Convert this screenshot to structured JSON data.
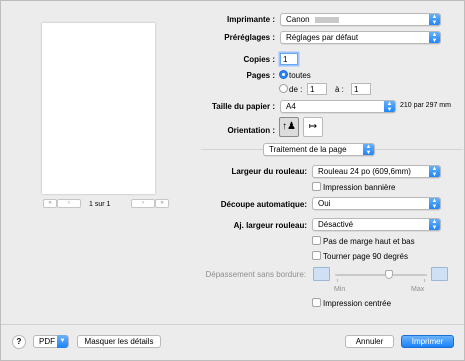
{
  "printer": {
    "label": "Imprimante :",
    "value": "Canon"
  },
  "presets": {
    "label": "Préréglages :",
    "value": "Réglages par défaut"
  },
  "copies": {
    "label": "Copies :",
    "value": "1"
  },
  "pages": {
    "label": "Pages :",
    "all_label": "toutes",
    "from_label": "de :",
    "from_value": "1",
    "to_label": "à :",
    "to_value": "1"
  },
  "paper_size": {
    "label": "Taille du papier :",
    "value": "A4",
    "dimensions": "210 par 297 mm"
  },
  "orientation": {
    "label": "Orientation :"
  },
  "section": {
    "value": "Traitement de la page"
  },
  "roll_width": {
    "label": "Largeur du rouleau:",
    "value": "Rouleau 24 po (609,6mm)"
  },
  "banner": {
    "label": "Impression bannière"
  },
  "auto_cut": {
    "label": "Découpe automatique:",
    "value": "Oui"
  },
  "adjust_roll": {
    "label": "Aj. largeur rouleau:",
    "value": "Désactivé"
  },
  "no_margin": {
    "label": "Pas de marge haut et bas"
  },
  "rotate": {
    "label": "Tourner page 90 degrés"
  },
  "overflow": {
    "label": "Dépassement sans bordure:",
    "min": "Min",
    "max": "Max"
  },
  "centered": {
    "label": "Impression centrée"
  },
  "preview_nav": {
    "first": "«",
    "prev": "‹",
    "page_indicator": "1 sur 1",
    "next": "›",
    "last": "»"
  },
  "footer": {
    "help": "?",
    "pdf": "PDF",
    "details": "Masquer les détails",
    "cancel": "Annuler",
    "print": "Imprimer"
  },
  "colors": {
    "accent": "#1a82fb"
  }
}
